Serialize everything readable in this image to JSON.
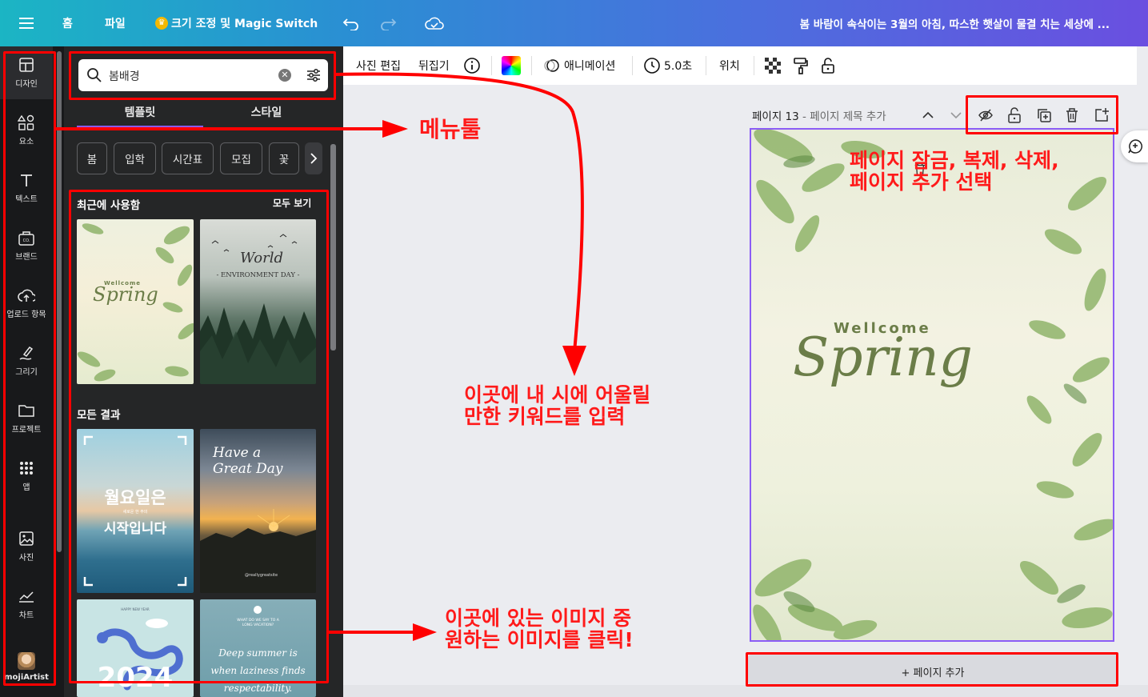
{
  "topbar": {
    "menu_icon": "hamburger-icon",
    "home": "홈",
    "file": "파일",
    "resize": "크기 조정 및 Magic Switch",
    "title": "봄 바람이 속삭이는 3월의 아침, 따스한 햇살이 물결 치는 세상에 ..."
  },
  "rail": {
    "items": [
      {
        "label": "디자인",
        "icon": "layout-icon"
      },
      {
        "label": "요소",
        "icon": "shapes-icon"
      },
      {
        "label": "텍스트",
        "icon": "text-icon"
      },
      {
        "label": "브랜드",
        "icon": "brand-icon"
      },
      {
        "label": "업로드 항목",
        "icon": "upload-icon"
      },
      {
        "label": "그리기",
        "icon": "draw-icon"
      },
      {
        "label": "프로젝트",
        "icon": "folder-icon"
      },
      {
        "label": "앱",
        "icon": "apps-icon"
      },
      {
        "label": "사진",
        "icon": "image-icon"
      },
      {
        "label": "차트",
        "icon": "chart-icon"
      },
      {
        "label": "mojiArtist",
        "icon": "avatar-icon"
      }
    ]
  },
  "panel": {
    "search_value": "봄배경",
    "tabs": [
      "템플릿",
      "스타일"
    ],
    "chips": [
      "봄",
      "입학",
      "시간표",
      "모집",
      "꽃"
    ],
    "recent_title": "최근에 사용함",
    "see_all": "모두 보기",
    "all_results": "모든 결과",
    "thumbs": {
      "t1_top": "Wellcome",
      "t1_main": "Spring",
      "t2_top": "World",
      "t2_sub": "- ENVIRONMENT DAY -",
      "t3_line1": "월요일은",
      "t3_small": "새로운 한 주의",
      "t3_line2": "시작입니다",
      "t4_line1": "Have a",
      "t4_line2": "Great Day",
      "t4_credit": "@reallygreatsite",
      "t5_top": "HAPPY NEW YEAR",
      "t5_year": "2024",
      "t6_top": "WHAT DO WE SAY TO A LONG VACATION?",
      "t6_line1": "Deep summer is",
      "t6_line2": "when laziness finds",
      "t6_line3": "respectability."
    }
  },
  "toolbar": {
    "edit_photo": "사진 편집",
    "flip": "뒤집기",
    "animation": "애니메이션",
    "duration": "5.0초",
    "position": "위치"
  },
  "canvas": {
    "page_label": "페이지 13",
    "page_title_placeholder": "- 페이지 제목 추가",
    "design_top": "Wellcome",
    "design_main": "Spring",
    "add_page": "+ 페이지 추가"
  },
  "annotations": {
    "menu_tool": "메뉴툴",
    "page_tools_1": "페이지 잠금, 복제, 삭제,",
    "page_tools_2": "페이지 추가 선택",
    "keyword_1": "이곳에 내 시에 어울릴",
    "keyword_2": "만한 키워드를 입력",
    "image_1": "이곳에 있는 이미지 중",
    "image_2": "원하는 이미지를 클릭!",
    "color": "#ff0000"
  }
}
